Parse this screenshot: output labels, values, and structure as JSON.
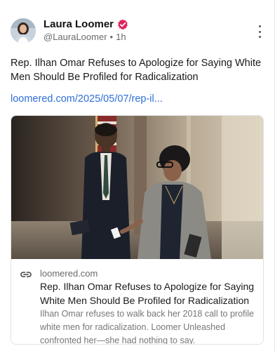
{
  "post": {
    "author": {
      "name": "Laura Loomer",
      "handle": "@LauraLoomer",
      "separator": "•",
      "time": "1h",
      "verified_color": "#e0245e"
    },
    "text": "Rep. Ilhan Omar Refuses to Apologize for Saying White Men Should Be Profiled for Radicalization",
    "link_text": "loomered.com/2025/05/07/rep-il...",
    "link_color": "#2f6fd8",
    "card": {
      "domain": "loomered.com",
      "title": "Rep. Ilhan Omar Refuses to Apologize for Saying White Men Should Be Profiled for Radicalization",
      "description": "Ilhan Omar refuses to walk back her 2018 call to profile white men for radicalization. Loomer Unleashed confronted her—she had nothing to say.",
      "image_alt_icon": "article-photo"
    },
    "icons": {
      "verified": "verified-badge-icon",
      "more": "more-vertical-icon",
      "link": "link-icon"
    }
  }
}
